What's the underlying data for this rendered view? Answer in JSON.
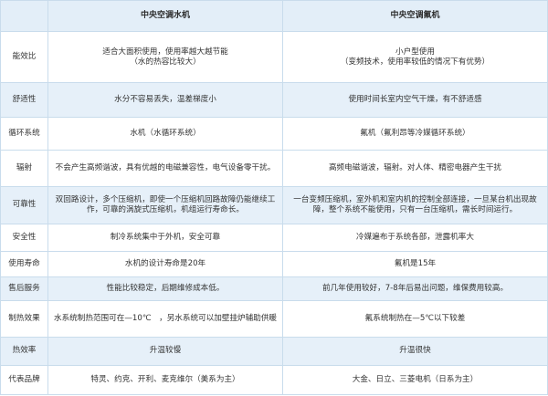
{
  "header": {
    "label": "",
    "water": "中央空调水机",
    "fluorine": "中央空调氟机"
  },
  "rows": [
    {
      "label": "能效比",
      "water": "适合大面积使用，使用率越大越节能\n（水的热容比较大）",
      "fluorine": "小户型使用\n（变频技术，使用率较低的情况下有优势）"
    },
    {
      "label": "舒适性",
      "water": "水分不容易丢失，温差梯度小",
      "fluorine": "使用时间长室内空气干燥，有不舒适感"
    },
    {
      "label": "循环系统",
      "water": "水机（水循环系统）",
      "fluorine": "氟机（氟利昂等冷媒循环系统）"
    },
    {
      "label": "辐射",
      "water": "不会产生高频谐波，具有优越的电磁兼容性，电气设备零干扰。",
      "fluorine": "高频电磁谐波，辐射。对人体、精密电器产生干扰"
    },
    {
      "label": "可靠性",
      "water": "双回路设计，多个压缩机，即使一个压缩机回路故障仍能继续工作，可靠的涡旋式压缩机，机组运行寿命长。",
      "fluorine": "一台变频压缩机，室外机和室内机的控制全部连接，一旦某台机出现故障，整个系统不能使用，只有一台压缩机，需长时间运行。"
    },
    {
      "label": "安全性",
      "water": "制冷系统集中于外机，安全可靠",
      "fluorine": "冷媒遍布于系统各部，泄露机率大"
    },
    {
      "label": "使用寿命",
      "water": "水机的设计寿命是20年",
      "fluorine": "氟机是15年"
    },
    {
      "label": "售后服务",
      "water": "性能比较稳定，后期维修成本低。",
      "fluorine": "前几年使用较好，7-8年后易出问题，维保费用较高。"
    },
    {
      "label": "制热效果",
      "water": "水系统制热范围可在—10℃　，另水系统可以加壁挂炉辅助供暖",
      "fluorine": "氟系统制热在—5℃以下较差"
    },
    {
      "label": "热效率",
      "water": "升温较慢",
      "fluorine": "升温很快"
    },
    {
      "label": "代表品牌",
      "water": "特灵、约克、开利、麦克维尔（美系为主）",
      "fluorine": "大金、日立、三菱电机（日系为主）"
    }
  ]
}
